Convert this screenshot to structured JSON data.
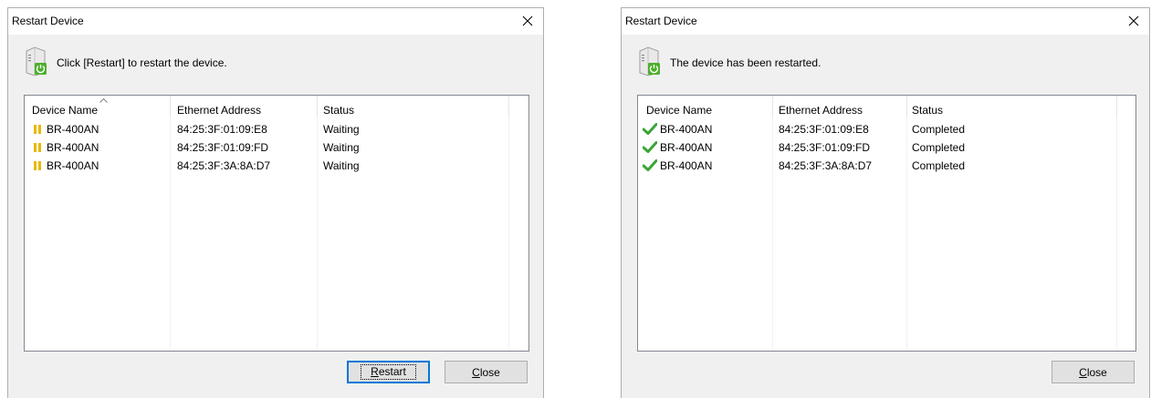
{
  "colors": {
    "accent": "#0078d7",
    "success_green": "#3aa535",
    "waiting_yellow": "#e8b800"
  },
  "left_dialog": {
    "title": "Restart Device",
    "message": "Click [Restart] to restart the device.",
    "columns": [
      "Device Name",
      "Ethernet Address",
      "Status"
    ],
    "rows": [
      {
        "icon": "waiting-icon",
        "name": "BR-400AN",
        "address": "84:25:3F:01:09:E8",
        "status": "Waiting"
      },
      {
        "icon": "waiting-icon",
        "name": "BR-400AN",
        "address": "84:25:3F:01:09:FD",
        "status": "Waiting"
      },
      {
        "icon": "waiting-icon",
        "name": "BR-400AN",
        "address": "84:25:3F:3A:8A:D7",
        "status": "Waiting"
      }
    ],
    "restart_button": {
      "accel": "R",
      "rest": "estart"
    },
    "close_button": {
      "accel": "C",
      "rest": "lose"
    }
  },
  "right_dialog": {
    "title": "Restart Device",
    "message": "The device has been restarted.",
    "columns": [
      "Device Name",
      "Ethernet Address",
      "Status"
    ],
    "rows": [
      {
        "icon": "check-icon",
        "name": "BR-400AN",
        "address": "84:25:3F:01:09:E8",
        "status": "Completed"
      },
      {
        "icon": "check-icon",
        "name": "BR-400AN",
        "address": "84:25:3F:01:09:FD",
        "status": "Completed"
      },
      {
        "icon": "check-icon",
        "name": "BR-400AN",
        "address": "84:25:3F:3A:8A:D7",
        "status": "Completed"
      }
    ],
    "close_button": {
      "accel": "C",
      "rest": "lose"
    }
  }
}
